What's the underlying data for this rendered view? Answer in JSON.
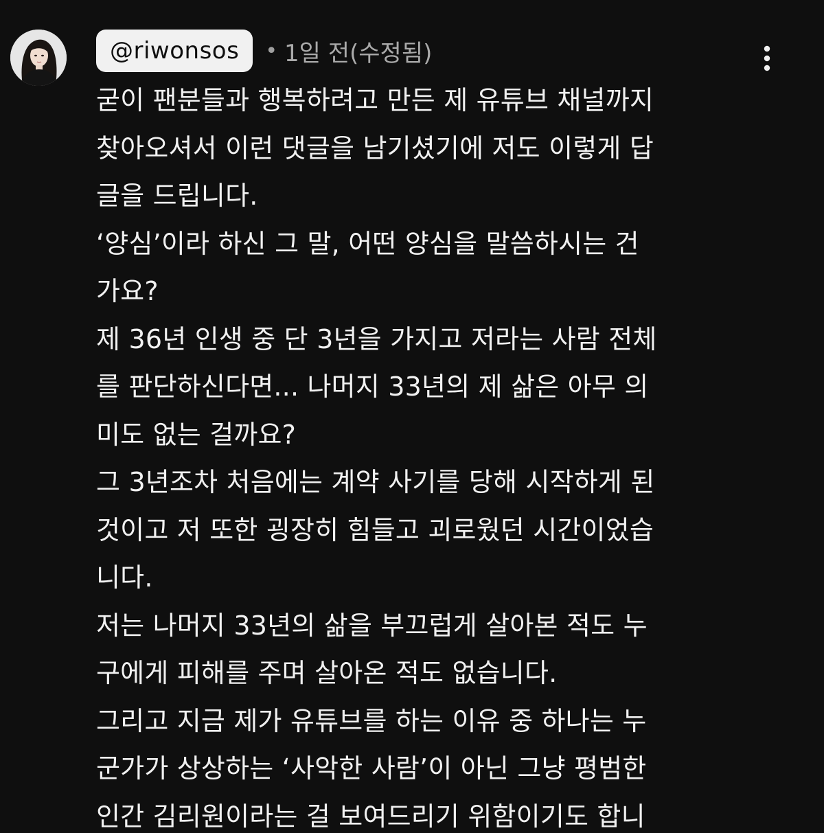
{
  "comment": {
    "handle": "@riwonsos",
    "separator": "•",
    "timestamp": "1일 전(수정됨)",
    "avatar_icon": "user-avatar-icon",
    "menu_icon": "more-vert-icon",
    "lines": [
      "굳이 팬분들과 행복하려고 만든 제 유튜브 채널까지",
      "찾아오셔서 이런 댓글을 남기셨기에 저도 이렇게 답",
      "글을 드립니다.",
      "‘양심’이라 하신 그 말, 어떤 양심을 말씀하시는 건",
      "가요?",
      "제 36년 인생 중 단 3년을 가지고 저라는 사람 전체",
      "를 판단하신다면... 나머지 33년의 제 삶은 아무 의",
      "미도 없는 걸까요?",
      "그 3년조차 처음에는 계약 사기를 당해 시작하게 된",
      "것이고 저 또한 굉장히 힘들고 괴로웠던 시간이었습",
      "니다.",
      "저는 나머지 33년의 삶을 부끄럽게 살아본 적도 누",
      "구에게 피해를 주며 살아온 적도 없습니다.",
      "그리고 지금 제가 유튜브를 하는 이유 중 하나는 누",
      "군가가 상상하는 ‘사악한 사람’이 아닌 그냥 평범한",
      "인간 김리원이라는 걸 보여드리기 위함이기도 합니"
    ]
  },
  "colors": {
    "background": "#0f0f0f",
    "text": "#f1f1f1",
    "secondary_text": "#aaaaaa",
    "handle_chip_bg": "#f1f1f1"
  }
}
